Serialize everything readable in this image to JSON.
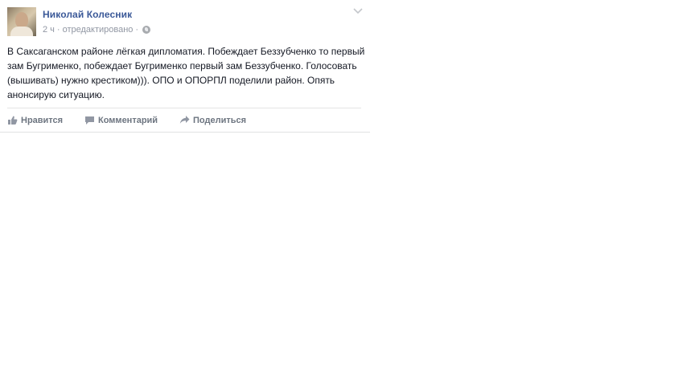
{
  "post": {
    "author": "Николай Колесник",
    "time": "2 ч",
    "separator": "·",
    "edited": "отредактировано",
    "privacy_icon": "globe-icon",
    "menu_icon": "chevron-down-icon",
    "text": "В Саксаганском районе лёгкая дипломатия. Побеждает Беззубченко то первый зам Бугрименко, побеждает Бугрименко первый зам Беззубченко. Голосовать (вышивать) нужно крестиком))). ОПО и ОПОРПЛ поделили район. Опять анонсирую ситуацию."
  },
  "actions": {
    "like": {
      "label": "Нравится",
      "icon": "thumbs-up-icon"
    },
    "comment": {
      "label": "Комментарий",
      "icon": "comment-icon"
    },
    "share": {
      "label": "Поделиться",
      "icon": "share-arrow-icon"
    }
  },
  "colors": {
    "author": "#3b5998",
    "meta": "#9197a3",
    "action": "#6d7580",
    "text": "#141823"
  }
}
